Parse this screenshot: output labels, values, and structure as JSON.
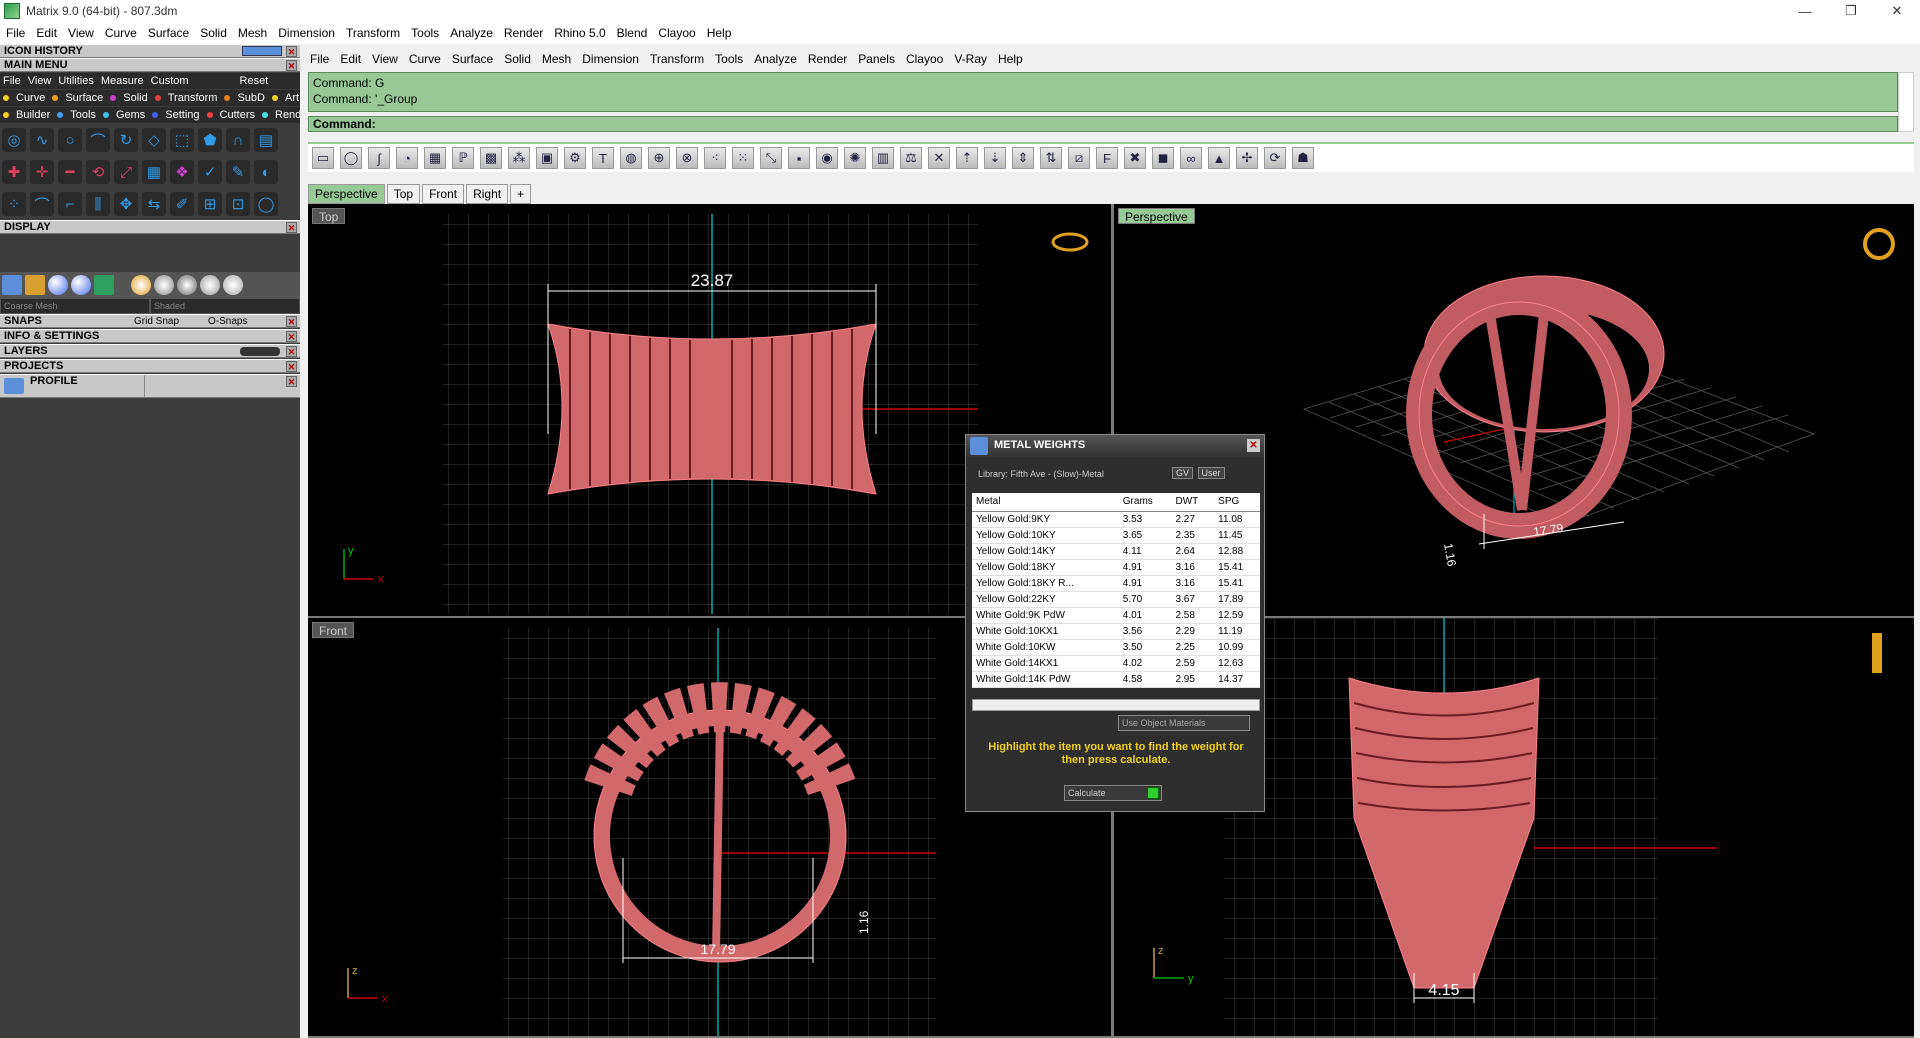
{
  "window": {
    "title": "Matrix 9.0 (64-bit) - 807.3dm",
    "min": "—",
    "max": "❐",
    "close": "✕"
  },
  "app_menu": [
    "File",
    "Edit",
    "View",
    "Curve",
    "Surface",
    "Solid",
    "Mesh",
    "Dimension",
    "Transform",
    "Tools",
    "Analyze",
    "Render",
    "Rhino 5.0",
    "Blend",
    "Clayoo",
    "Help"
  ],
  "left": {
    "icon_history": "ICON HISTORY",
    "main_menu": "MAIN MENU",
    "submenu": [
      "File",
      "View",
      "Utilities",
      "Measure",
      "Custom"
    ],
    "reset": "Reset",
    "row1": [
      {
        "label": "Curve",
        "color": "#f0d020"
      },
      {
        "label": "Surface",
        "color": "#f0a020"
      },
      {
        "label": "Solid",
        "color": "#d040d0"
      },
      {
        "label": "Transform",
        "color": "#e04040"
      },
      {
        "label": "SubD",
        "color": "#e08020"
      },
      {
        "label": "Art",
        "color": "#f0d020"
      }
    ],
    "row2": [
      {
        "label": "Builder",
        "color": "#f0d020"
      },
      {
        "label": "Tools",
        "color": "#40a0f0"
      },
      {
        "label": "Gems",
        "color": "#40c0f0"
      },
      {
        "label": "Setting",
        "color": "#4060f0"
      },
      {
        "label": "Cutters",
        "color": "#f04040"
      },
      {
        "label": "Render",
        "color": "#40e0e0"
      }
    ],
    "display": "DISPLAY",
    "coarse_mesh": "Coarse Mesh",
    "shaded": "Shaded",
    "snaps": "SNAPS",
    "grid_snap": "Grid Snap",
    "o_snaps": "O-Snaps",
    "info": "INFO & SETTINGS",
    "layers": "LAYERS",
    "projects": "PROJECTS",
    "profile": "PROFILE"
  },
  "rhino_menu": [
    "File",
    "Edit",
    "View",
    "Curve",
    "Surface",
    "Solid",
    "Mesh",
    "Dimension",
    "Transform",
    "Tools",
    "Analyze",
    "Render",
    "Panels",
    "Clayoo",
    "V-Ray",
    "Help"
  ],
  "command": {
    "line1": "Command: G",
    "line2": "Command: '_Group",
    "prompt": "Command:"
  },
  "viewport_tabs": [
    "Perspective",
    "Top",
    "Front",
    "Right"
  ],
  "viewport_tab_add": "+",
  "viewports": {
    "top": {
      "label": "Top",
      "dim": "23.87",
      "axis_y": "y",
      "axis_x": "x"
    },
    "perspective": {
      "label": "Perspective",
      "dim1": "1.16",
      "dim2": "17.79"
    },
    "front": {
      "label": "Front",
      "dim1": "17.79",
      "dim2": "1.16",
      "axis_z": "z",
      "axis_x": "x"
    },
    "right": {
      "dim": "4.15",
      "axis_z": "z",
      "axis_y": "y"
    }
  },
  "metal_weights": {
    "title": "METAL WEIGHTS",
    "close": "✕",
    "library": "Library: Fifth Ave - (Slow)-Metal",
    "gv": "GV",
    "user": "User",
    "columns": [
      "Metal",
      "Grams",
      "DWT",
      "SPG"
    ],
    "rows": [
      [
        "Yellow Gold:9KY",
        "3.53",
        "2.27",
        "11.08"
      ],
      [
        "Yellow Gold:10KY",
        "3.65",
        "2.35",
        "11.45"
      ],
      [
        "Yellow Gold:14KY",
        "4.11",
        "2.64",
        "12.88"
      ],
      [
        "Yellow Gold:18KY",
        "4.91",
        "3.16",
        "15.41"
      ],
      [
        "Yellow Gold:18KY R...",
        "4.91",
        "3.16",
        "15.41"
      ],
      [
        "Yellow Gold:22KY",
        "5.70",
        "3.67",
        "17.89"
      ],
      [
        "White Gold:9K PdW",
        "4.01",
        "2.58",
        "12.59"
      ],
      [
        "White Gold:10KX1",
        "3.56",
        "2.29",
        "11.19"
      ],
      [
        "White Gold:10KW",
        "3.50",
        "2.25",
        "10.99"
      ],
      [
        "White Gold:14KX1",
        "4.02",
        "2.59",
        "12.63"
      ],
      [
        "White Gold:14K PdW",
        "4.58",
        "2.95",
        "14.37"
      ]
    ],
    "use_object_materials": "Use Object Materials",
    "message": "Highlight the item you want to find the weight for then press calculate.",
    "calculate": "Calculate"
  }
}
